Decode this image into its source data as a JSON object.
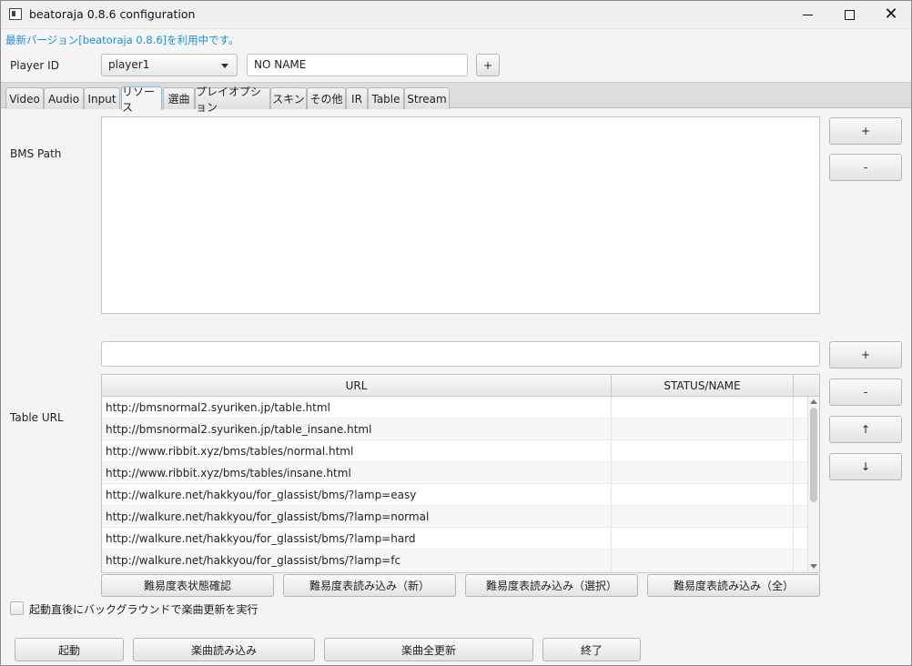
{
  "window": {
    "title": "beatoraja 0.8.6 configuration",
    "minimize": "",
    "maximize": "",
    "close": "✕"
  },
  "version_notice": "最新バージョン[beatoraja 0.8.6]を利用中です。",
  "player": {
    "label": "Player ID",
    "selected": "player1",
    "name_value": "NO NAME",
    "add_label": "+"
  },
  "tabs": [
    {
      "label": "Video"
    },
    {
      "label": "Audio"
    },
    {
      "label": "Input"
    },
    {
      "label": "リソース",
      "active": true
    },
    {
      "label": "選曲"
    },
    {
      "label": "プレイオプション"
    },
    {
      "label": "スキン"
    },
    {
      "label": "その他"
    },
    {
      "label": "IR"
    },
    {
      "label": "Table"
    },
    {
      "label": "Stream"
    }
  ],
  "bms_path": {
    "label": "BMS Path",
    "add_label": "+",
    "remove_label": "-"
  },
  "table_url": {
    "label": "Table URL",
    "input_value": "",
    "add_label": "+",
    "remove_label": "-",
    "up_label": "↑",
    "down_label": "↓",
    "columns": [
      "URL",
      "STATUS/NAME"
    ],
    "rows": [
      {
        "url": "http://bmsnormal2.syuriken.jp/table.html",
        "status": ""
      },
      {
        "url": "http://bmsnormal2.syuriken.jp/table_insane.html",
        "status": ""
      },
      {
        "url": "http://www.ribbit.xyz/bms/tables/normal.html",
        "status": ""
      },
      {
        "url": "http://www.ribbit.xyz/bms/tables/insane.html",
        "status": ""
      },
      {
        "url": "http://walkure.net/hakkyou/for_glassist/bms/?lamp=easy",
        "status": ""
      },
      {
        "url": "http://walkure.net/hakkyou/for_glassist/bms/?lamp=normal",
        "status": ""
      },
      {
        "url": "http://walkure.net/hakkyou/for_glassist/bms/?lamp=hard",
        "status": ""
      },
      {
        "url": "http://walkure.net/hakkyou/for_glassist/bms/?lamp=fc",
        "status": ""
      }
    ],
    "actions": [
      "難易度表状態確認",
      "難易度表読み込み（新）",
      "難易度表読み込み（選択）",
      "難易度表読み込み（全）"
    ]
  },
  "background_update": {
    "label": "起動直後にバックグラウンドで楽曲更新を実行",
    "checked": false
  },
  "footer": {
    "start_label": "起動",
    "load_songs_label": "楽曲読み込み",
    "update_all_label": "楽曲全更新",
    "exit_label": "終了"
  }
}
